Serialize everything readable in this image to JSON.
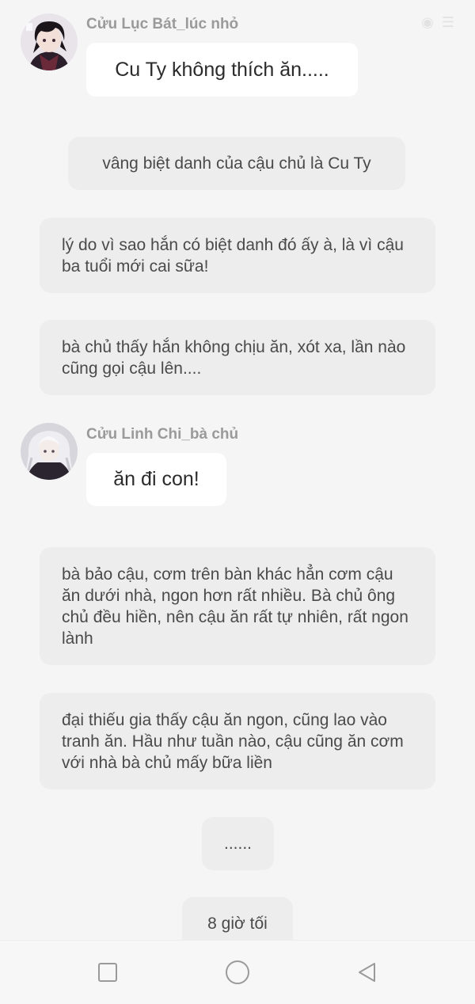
{
  "messages": {
    "sender1": "Cửu Lục Bát_lúc nhỏ",
    "bubble1": "Cu Ty không thích ăn.....",
    "narr1": "vâng biệt danh của cậu chủ là Cu Ty",
    "narr2": "lý do vì sao hắn có biệt danh đó ấy à, là vì cậu ba tuổi mới cai sữa!",
    "narr3": "bà chủ thấy hắn không chịu ăn, xót xa, lần nào cũng gọi cậu lên....",
    "sender2": "Cửu Linh Chi_bà chủ",
    "bubble2": "ăn đi con!",
    "narr4": "bà bảo cậu, cơm trên bàn khác hẳn cơm cậu ăn dưới nhà, ngon hơn rất nhiều. Bà chủ ông chủ đều hiền, nên cậu ăn rất tự nhiên, rất ngon lành",
    "narr5": "đại thiếu gia thấy cậu ăn ngon, cũng lao vào tranh ăn. Hầu như tuần nào, cậu cũng ăn cơm với nhà bà chủ mấy bữa liền",
    "narr6": "......",
    "narr7": "8 giờ tối"
  },
  "icons": {
    "status": [
      "eye-icon",
      "list-icon"
    ],
    "nav": [
      "square-icon",
      "circle-icon",
      "triangle-back-icon"
    ]
  },
  "colors": {
    "background": "#f5f5f5",
    "bubble": "#ffffff",
    "narration": "#ededed",
    "sender_text": "#9a9a9a"
  }
}
